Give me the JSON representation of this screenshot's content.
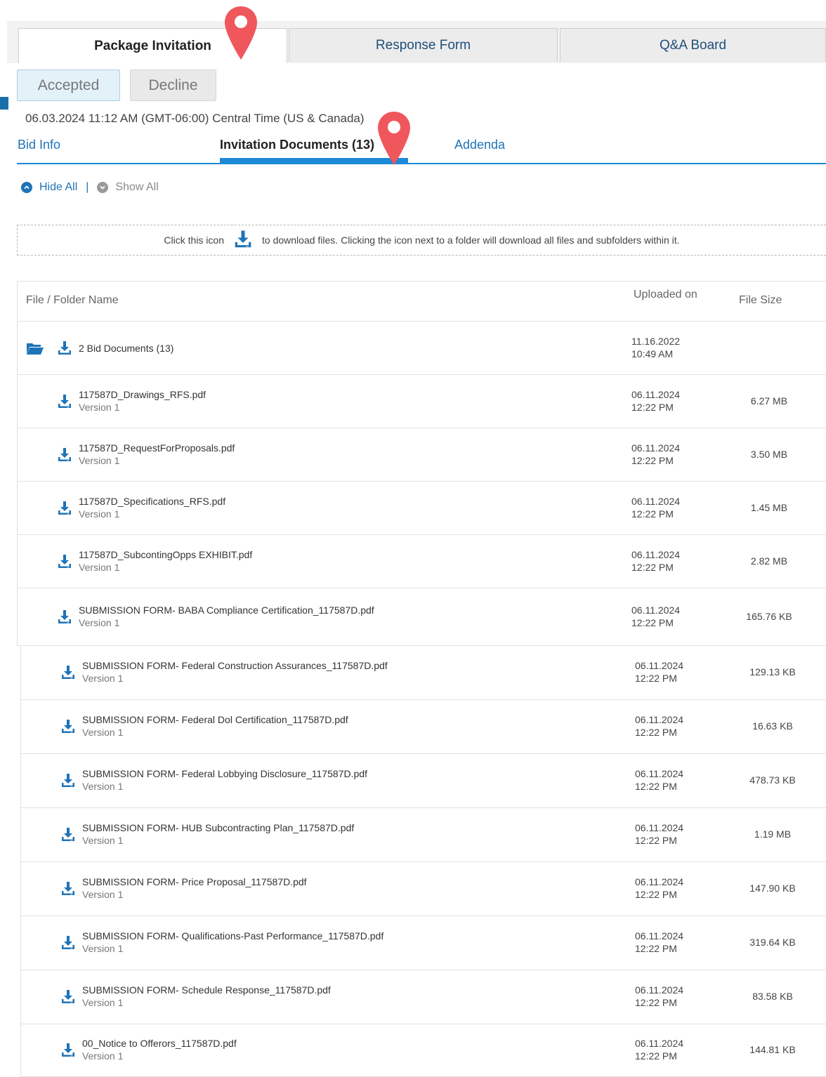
{
  "top_tabs": [
    "Package Invitation",
    "Response Form",
    "Q&A Board"
  ],
  "buttons": {
    "accepted": "Accepted",
    "decline": "Decline"
  },
  "timestamp": "06.03.2024 11:12 AM (GMT-06:00) Central Time (US & Canada)",
  "sub_tabs": [
    "Bid Info",
    "Invitation Documents (13)",
    "Addenda"
  ],
  "toggles": {
    "hide_all": "Hide All",
    "separator": "|",
    "show_all": "Show All"
  },
  "notice": {
    "before": "Click this icon",
    "after": "to download files. Clicking the icon next to a folder will download all files and subfolders within it."
  },
  "table": {
    "headers": {
      "name": "File / Folder Name",
      "uploaded": "Uploaded on",
      "size": "File Size"
    },
    "folder": {
      "name": "2 Bid Documents (13)",
      "date": "11.16.2022",
      "time": "10:49 AM"
    },
    "files": [
      {
        "name": "117587D_Drawings_RFS.pdf",
        "version": "Version 1",
        "date": "06.11.2024",
        "time": "12:22 PM",
        "size": "6.27 MB"
      },
      {
        "name": "117587D_RequestForProposals.pdf",
        "version": "Version 1",
        "date": "06.11.2024",
        "time": "12:22 PM",
        "size": "3.50 MB"
      },
      {
        "name": "117587D_Specifications_RFS.pdf",
        "version": "Version 1",
        "date": "06.11.2024",
        "time": "12:22 PM",
        "size": "1.45 MB"
      },
      {
        "name": "117587D_SubcontingOpps EXHIBIT.pdf",
        "version": "Version 1",
        "date": "06.11.2024",
        "time": "12:22 PM",
        "size": "2.82 MB"
      },
      {
        "name": "SUBMISSION FORM- BABA Compliance Certification_117587D.pdf",
        "version": "Version 1",
        "date": "06.11.2024",
        "time": "12:22 PM",
        "size": "165.76 KB"
      },
      {
        "name": "SUBMISSION FORM- Federal Construction Assurances_117587D.pdf",
        "version": "Version 1",
        "date": "06.11.2024",
        "time": "12:22 PM",
        "size": "129.13 KB"
      },
      {
        "name": "SUBMISSION FORM- Federal Dol Certification_117587D.pdf",
        "version": "Version 1",
        "date": "06.11.2024",
        "time": "12:22 PM",
        "size": "16.63 KB"
      },
      {
        "name": "SUBMISSION FORM- Federal Lobbying Disclosure_117587D.pdf",
        "version": "Version 1",
        "date": "06.11.2024",
        "time": "12:22 PM",
        "size": "478.73 KB"
      },
      {
        "name": "SUBMISSION FORM- HUB Subcontracting Plan_117587D.pdf",
        "version": "Version 1",
        "date": "06.11.2024",
        "time": "12:22 PM",
        "size": "1.19 MB"
      },
      {
        "name": "SUBMISSION FORM- Price Proposal_117587D.pdf",
        "version": "Version 1",
        "date": "06.11.2024",
        "time": "12:22 PM",
        "size": "147.90 KB"
      },
      {
        "name": "SUBMISSION FORM- Qualifications-Past Performance_117587D.pdf",
        "version": "Version 1",
        "date": "06.11.2024",
        "time": "12:22 PM",
        "size": "319.64 KB"
      },
      {
        "name": "SUBMISSION FORM- Schedule Response_117587D.pdf",
        "version": "Version 1",
        "date": "06.11.2024",
        "time": "12:22 PM",
        "size": "83.58 KB"
      },
      {
        "name": "00_Notice to Offerors_117587D.pdf",
        "version": "Version 1",
        "date": "06.11.2024",
        "time": "12:22 PM",
        "size": "144.81 KB"
      }
    ]
  },
  "colors": {
    "accent": "#1c8ad6",
    "link": "#1f73b7",
    "pin": "#f0575d"
  },
  "icons": [
    "download-icon",
    "folder-open-icon",
    "chevron-up-circle-icon",
    "chevron-down-circle-icon",
    "location-pin-icon"
  ]
}
